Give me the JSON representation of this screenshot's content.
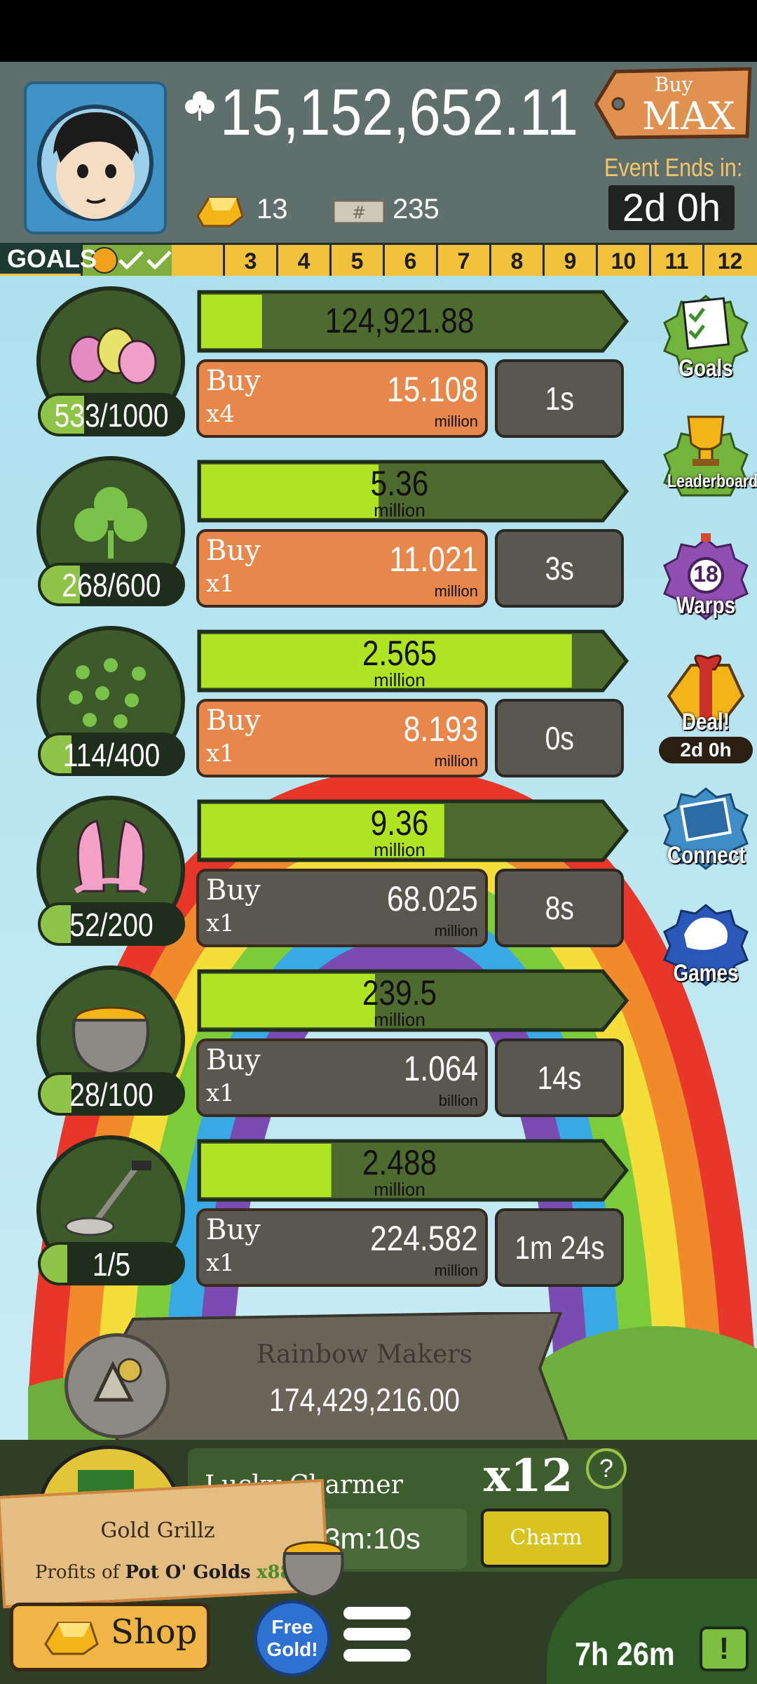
{
  "header": {
    "currency_value": "15,152,652.11",
    "gold_count": "13",
    "tickets_count": "235",
    "buy_max_line1": "Buy",
    "buy_max_line2": "MAX",
    "event_label": "Event Ends in:",
    "event_time": "2d 0h"
  },
  "goals_bar": {
    "label": "GOALS",
    "completed": 2,
    "numbers": [
      "3",
      "4",
      "5",
      "6",
      "7",
      "8",
      "9",
      "10",
      "11",
      "12"
    ]
  },
  "businesses": [
    {
      "name": "eggs",
      "count": "533/1000",
      "count_fraction": 0.533,
      "progress_fraction": 0.09,
      "progress_value": "124,921.88",
      "progress_unit": "",
      "buy_label": "Buy",
      "buy_mult": "x4",
      "price": "15.108",
      "price_unit": "million",
      "time": "1s",
      "buy_style": "orange"
    },
    {
      "name": "clover",
      "count": "268/600",
      "count_fraction": 0.447,
      "progress_fraction": 0.41,
      "progress_value": "5.36",
      "progress_unit": "million",
      "buy_label": "Buy",
      "buy_mult": "x1",
      "price": "11.021",
      "price_unit": "million",
      "time": "3s",
      "buy_style": "orange"
    },
    {
      "name": "clover-field",
      "count": "114/400",
      "count_fraction": 0.285,
      "progress_fraction": 0.94,
      "progress_value": "2.565",
      "progress_unit": "million",
      "buy_label": "Buy",
      "buy_mult": "x1",
      "price": "8.193",
      "price_unit": "million",
      "time": "0s",
      "buy_style": "orange"
    },
    {
      "name": "bunny-ears",
      "count": "52/200",
      "count_fraction": 0.26,
      "progress_fraction": 0.59,
      "progress_value": "9.36",
      "progress_unit": "million",
      "buy_label": "Buy",
      "buy_mult": "x1",
      "price": "68.025",
      "price_unit": "million",
      "time": "8s",
      "buy_style": "gray"
    },
    {
      "name": "pot-of-gold",
      "count": "28/100",
      "count_fraction": 0.28,
      "progress_fraction": 0.4,
      "progress_value": "239.5",
      "progress_unit": "million",
      "buy_label": "Buy",
      "buy_mult": "x1",
      "price": "1.064",
      "price_unit": "billion",
      "time": "14s",
      "buy_style": "gray"
    },
    {
      "name": "metal-detector",
      "count": "1/5",
      "count_fraction": 0.2,
      "progress_fraction": 0.28,
      "progress_value": "2.488",
      "progress_unit": "million",
      "buy_label": "Buy",
      "buy_mult": "x1",
      "price": "224.582",
      "price_unit": "million",
      "time": "1m 24s",
      "buy_style": "gray"
    }
  ],
  "side_menu": {
    "goals": "Goals",
    "leaderboard": "Leaderboard",
    "warps_count": "18",
    "warps": "Warps",
    "deal": "Deal!",
    "deal_time": "2d 0h",
    "connect": "Connect",
    "games": "Games"
  },
  "manager": {
    "name": "Rainbow Makers",
    "value": "174,429,216.00"
  },
  "charm": {
    "name": "Lucky Charmer",
    "multiplier": "x12",
    "help": "?",
    "timer": "3m:10s",
    "button": "Charm"
  },
  "tooltip": {
    "title": "Gold Grillz",
    "desc_prefix": "Profits of",
    "desc_target": "Pot O' Golds",
    "desc_mult": "x88"
  },
  "bottom": {
    "shop": "Shop",
    "free_gold": "Free Gold!",
    "tv_timer": "7h 26m",
    "tv_icon": "!"
  },
  "colors": {
    "progress_green": "#aee422",
    "progress_dark": "#4f6a2e",
    "buy_orange": "#e8874b",
    "buy_gray": "#5a5751",
    "header_bg": "#5f6f6c",
    "goals_yellow": "#f2c23a"
  }
}
